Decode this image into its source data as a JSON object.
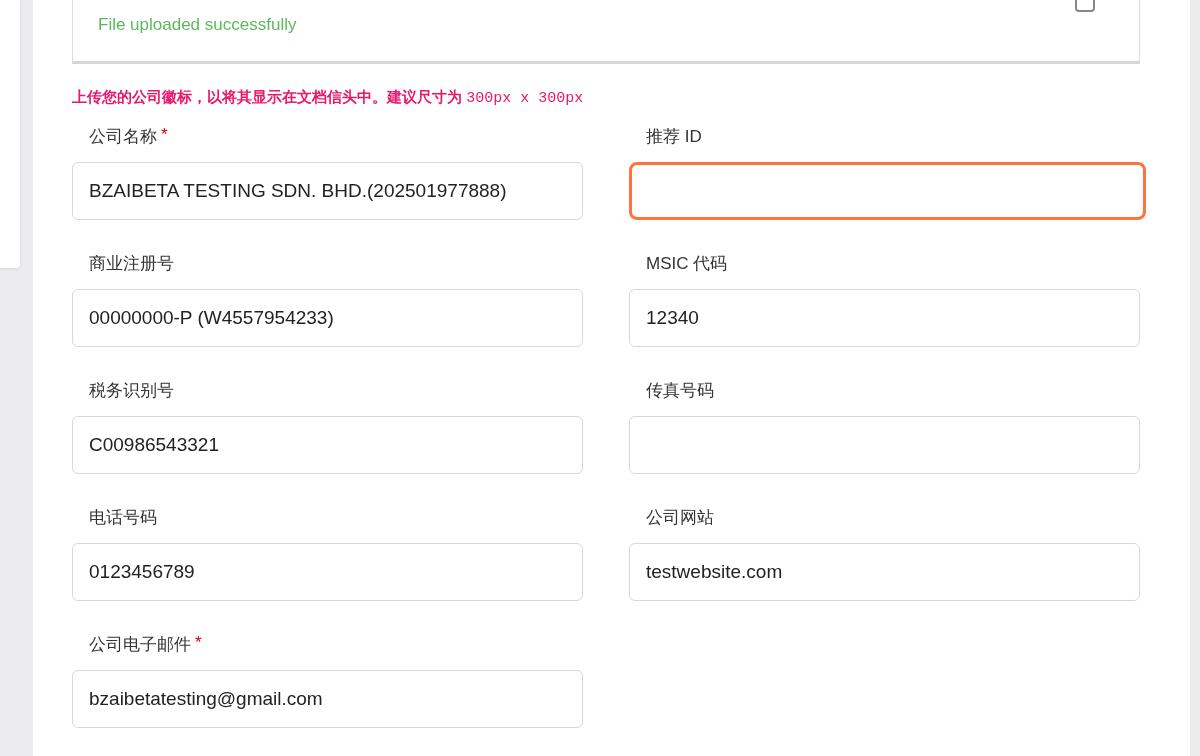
{
  "upload": {
    "status": "File uploaded successfully",
    "checkbox": {
      "checked": false
    }
  },
  "hint": {
    "text": "上传您的公司徽标，以将其显示在文档信头中。建议尺寸为",
    "size": "300px x 300px"
  },
  "fields": [
    {
      "label": "公司名称",
      "required_mark": "*",
      "value": "BZAIBETA TESTING SDN. BHD.(202501977888)",
      "focused": false
    },
    {
      "label": "推荐 ID",
      "focused": true
    },
    {
      "label": "商业注册号",
      "value": "00000000-P (W4557954233)",
      "focused": false
    },
    {
      "label": "MSIC 代码",
      "value": "12340",
      "focused": false
    },
    {
      "label": "税务识别号",
      "value": "C00986543321",
      "focused": false
    },
    {
      "label": "传真号码",
      "focused": false
    },
    {
      "label": "电话号码",
      "value": "0123456789",
      "focused": false
    },
    {
      "label": "公司网站",
      "value": "testwebsite.com",
      "focused": false
    },
    {
      "label": "公司电子邮件",
      "required_mark": "*",
      "value": "bzaibetatesting@gmail.com",
      "focused": false
    }
  ]
}
